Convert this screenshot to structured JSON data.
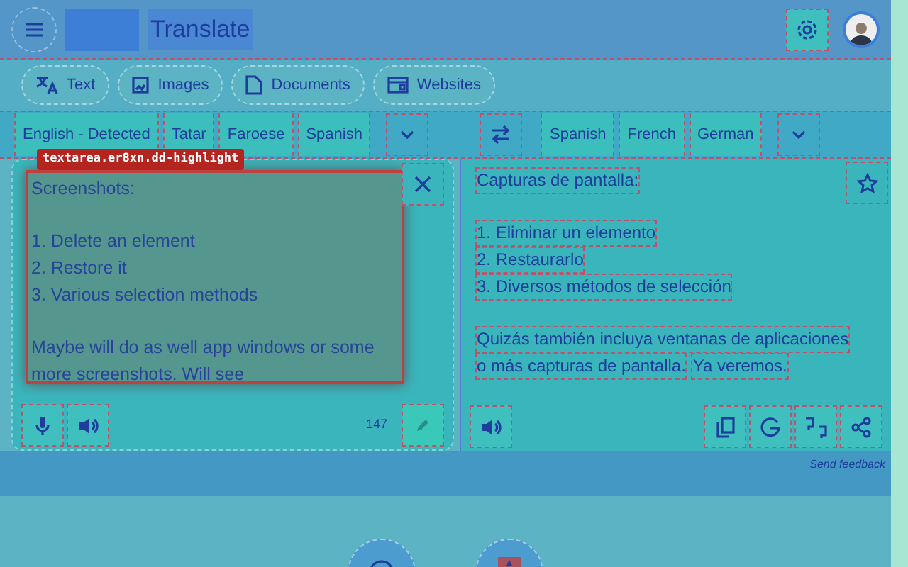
{
  "header": {
    "title": "Translate"
  },
  "modes": [
    "Text",
    "Images",
    "Documents",
    "Websites"
  ],
  "source_languages": [
    "English - Detected",
    "Tatar",
    "Faroese",
    "Spanish"
  ],
  "target_languages": [
    "Spanish",
    "French",
    "German"
  ],
  "highlight_label": "textarea.er8xn.dd-highlight",
  "source_text": "Screenshots:\n\n1. Delete an element\n2. Restore it\n3. Various selection methods\n\nMaybe will do as well app windows or some more screenshots. Will see",
  "char_count": "147",
  "translation": [
    [
      [
        "Capturas de pantalla:"
      ]
    ],
    [
      [
        "1. Eliminar un elemento"
      ],
      [
        "2. Restaurarlo"
      ],
      [
        "3. Diversos métodos de selección"
      ]
    ],
    [
      [
        "Quizás también incluya ventanas de aplicaciones"
      ],
      [
        "o más capturas de pantalla.",
        "Ya veremos."
      ]
    ]
  ],
  "feedback_link": "Send feedback"
}
